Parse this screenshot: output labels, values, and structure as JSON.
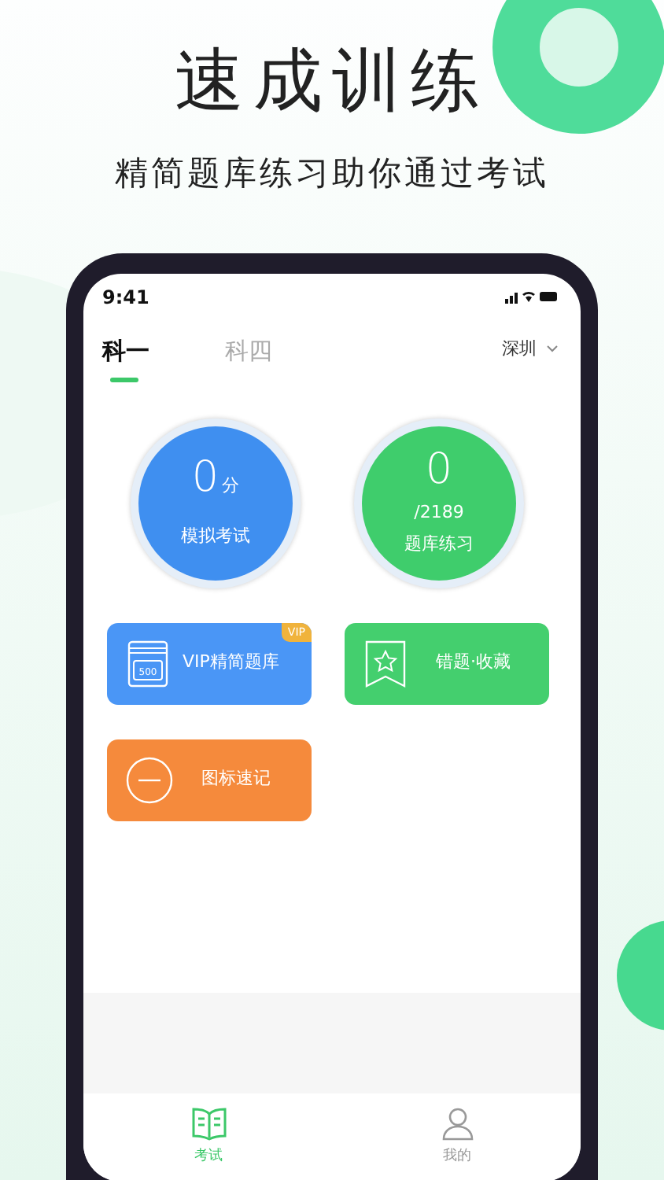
{
  "headline": "速成训练",
  "subtitle": "精简题库练习助你通过考试",
  "status_bar": {
    "time": "9:41"
  },
  "tabs": [
    {
      "label": "科一",
      "selected": true
    },
    {
      "label": "科四",
      "selected": false
    }
  ],
  "city": {
    "label": "深圳"
  },
  "stats": [
    {
      "value": "0",
      "unit": "分",
      "label": "模拟考试",
      "color": "#3f8ff0"
    },
    {
      "value": "0",
      "sub": "/2189",
      "label": "题库练习",
      "color": "#3fcd6c"
    }
  ],
  "tiles": [
    {
      "label": "VIP精简题库",
      "color": "#4a96f6",
      "badge": "VIP",
      "kind": "book",
      "cover_text": "500"
    },
    {
      "label": "错题·收藏",
      "color": "#44cf6e",
      "kind": "bookmark"
    },
    {
      "label": "图标速记",
      "color": "#f58a3c",
      "kind": "minus"
    }
  ],
  "bottom_nav": [
    {
      "label": "考试",
      "selected": true
    },
    {
      "label": "我的",
      "selected": false
    }
  ]
}
